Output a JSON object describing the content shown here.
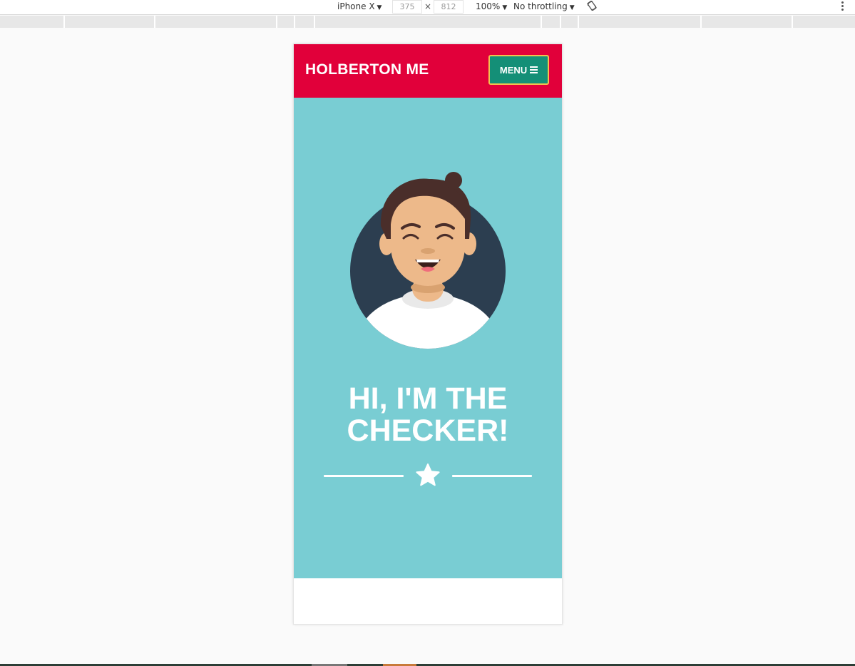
{
  "devtools": {
    "device": "iPhone X",
    "width": "375",
    "times": "×",
    "height": "812",
    "zoom": "100%",
    "throttling": "No throttling",
    "caret": "▼"
  },
  "site": {
    "brand": "HOLBERTON ME",
    "menu_label": "MENU",
    "hero_title_line1": "HI, I'M THE",
    "hero_title_line2": "CHECKER!"
  },
  "colors": {
    "header": "#e1003a",
    "menu_button": "#148f77",
    "menu_border": "#f2c14e",
    "hero": "#79cdd3",
    "avatar_circle": "#2c3e50",
    "hair": "#4a2e2a",
    "skin": "#edb98a"
  },
  "icons": {
    "menu": "hamburger-icon",
    "divider": "star-icon",
    "rotate": "rotate-icon",
    "more": "more-vertical-icon"
  }
}
